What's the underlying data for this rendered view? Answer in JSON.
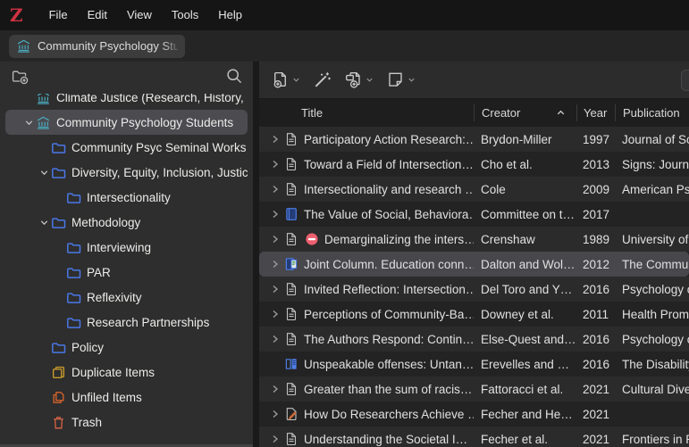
{
  "app": {
    "logo_letter": "Z",
    "menus": [
      {
        "label": "File"
      },
      {
        "label": "Edit"
      },
      {
        "label": "View"
      },
      {
        "label": "Tools"
      },
      {
        "label": "Help"
      }
    ]
  },
  "tab_bar": {
    "tabs": [
      {
        "label": "Community Psychology Stude",
        "icon": "library"
      }
    ]
  },
  "sidebar": {
    "items": [
      {
        "label": "Climate Justice (Research, History, Bell",
        "icon": "library",
        "depth": 0,
        "chevron": false,
        "selected": false,
        "clipped": true
      },
      {
        "label": "Community Psychology Students",
        "icon": "library",
        "depth": 0,
        "chevron": true,
        "selected": true,
        "clipped": false
      },
      {
        "label": "Community Psyc Seminal Works",
        "icon": "folder",
        "depth": 1,
        "chevron": false,
        "selected": false,
        "clipped": false
      },
      {
        "label": "Diversity, Equity, Inclusion, Justice",
        "icon": "folder",
        "depth": 1,
        "chevron": true,
        "selected": false,
        "clipped": false
      },
      {
        "label": "Intersectionality",
        "icon": "folder",
        "depth": 2,
        "chevron": false,
        "selected": false,
        "clipped": false
      },
      {
        "label": "Methodology",
        "icon": "folder",
        "depth": 1,
        "chevron": true,
        "selected": false,
        "clipped": false
      },
      {
        "label": "Interviewing",
        "icon": "folder",
        "depth": 2,
        "chevron": false,
        "selected": false,
        "clipped": false
      },
      {
        "label": "PAR",
        "icon": "folder",
        "depth": 2,
        "chevron": false,
        "selected": false,
        "clipped": false
      },
      {
        "label": "Reflexivity",
        "icon": "folder",
        "depth": 2,
        "chevron": false,
        "selected": false,
        "clipped": false
      },
      {
        "label": "Research Partnerships",
        "icon": "folder",
        "depth": 2,
        "chevron": false,
        "selected": false,
        "clipped": false
      },
      {
        "label": "Policy",
        "icon": "folder",
        "depth": 1,
        "chevron": false,
        "selected": false,
        "clipped": false
      },
      {
        "label": "Duplicate Items",
        "icon": "duplicates",
        "depth": 1,
        "chevron": false,
        "selected": false,
        "clipped": false
      },
      {
        "label": "Unfiled Items",
        "icon": "unfiled",
        "depth": 1,
        "chevron": false,
        "selected": false,
        "clipped": false
      },
      {
        "label": "Trash",
        "icon": "trash",
        "depth": 1,
        "chevron": false,
        "selected": false,
        "clipped": false
      }
    ]
  },
  "main": {
    "toolbar": {
      "buttons": [
        {
          "name": "new-item",
          "icon": "new-item",
          "dropdown": true
        },
        {
          "name": "add-by-identifier",
          "icon": "wand",
          "dropdown": false
        },
        {
          "name": "new-attachment",
          "icon": "attachment",
          "dropdown": true
        },
        {
          "name": "new-note",
          "icon": "note",
          "dropdown": true
        }
      ]
    },
    "table": {
      "columns": [
        {
          "id": "title",
          "label": "Title",
          "sort": null
        },
        {
          "id": "creator",
          "label": "Creator",
          "sort": "asc"
        },
        {
          "id": "year",
          "label": "Year",
          "sort": null
        },
        {
          "id": "publication",
          "label": "Publication",
          "sort": null
        }
      ],
      "rows": [
        {
          "twisty": true,
          "icon": "document",
          "emoji": false,
          "title": "Participatory Action Research:…",
          "creator": "Brydon-Miller",
          "year": "1997",
          "publication": "Journal of Soc",
          "selected": false
        },
        {
          "twisty": true,
          "icon": "document",
          "emoji": false,
          "title": "Toward a Field of Intersection…",
          "creator": "Cho et al.",
          "year": "2013",
          "publication": "Signs: Journa",
          "selected": false
        },
        {
          "twisty": true,
          "icon": "document",
          "emoji": false,
          "title": "Intersectionality and research …",
          "creator": "Cole",
          "year": "2009",
          "publication": "American Psy",
          "selected": false
        },
        {
          "twisty": true,
          "icon": "book",
          "emoji": false,
          "title": "The Value of Social, Behaviora…",
          "creator": "Committee on t…",
          "year": "2017",
          "publication": "",
          "selected": false
        },
        {
          "twisty": true,
          "icon": "document",
          "emoji": true,
          "title": "Demarginalizing the inters…",
          "creator": "Crenshaw",
          "year": "1989",
          "publication": "University of ",
          "selected": false
        },
        {
          "twisty": true,
          "icon": "magazine",
          "emoji": false,
          "title": "Joint Column. Education conn…",
          "creator": "Dalton and Wol…",
          "year": "2012",
          "publication": "The Commun",
          "selected": true
        },
        {
          "twisty": true,
          "icon": "document",
          "emoji": false,
          "title": "Invited Reflection: Intersection…",
          "creator": "Del Toro and Y…",
          "year": "2016",
          "publication": "Psychology o",
          "selected": false
        },
        {
          "twisty": true,
          "icon": "document",
          "emoji": false,
          "title": "Perceptions of Community-Ba…",
          "creator": "Downey et al.",
          "year": "2011",
          "publication": "Health Prom",
          "selected": false
        },
        {
          "twisty": true,
          "icon": "document",
          "emoji": false,
          "title": "The Authors Respond: Contin…",
          "creator": "Else-Quest and…",
          "year": "2016",
          "publication": "Psychology o",
          "selected": false
        },
        {
          "twisty": false,
          "icon": "book-section",
          "emoji": false,
          "title": "Unspeakable offenses: Untan…",
          "creator": "Erevelles and …",
          "year": "2016",
          "publication": "The Disability",
          "selected": false
        },
        {
          "twisty": true,
          "icon": "document",
          "emoji": false,
          "title": "Greater than the sum of racis…",
          "creator": "Fattoracci et al.",
          "year": "2021",
          "publication": "Cultural Diver",
          "selected": false
        },
        {
          "twisty": true,
          "icon": "blog",
          "emoji": false,
          "title": "How Do Researchers Achieve …",
          "creator": "Fecher and He…",
          "year": "2021",
          "publication": "",
          "selected": false
        },
        {
          "twisty": true,
          "icon": "document",
          "emoji": false,
          "title": "Understanding the Societal I…",
          "creator": "Fecher et al.",
          "year": "2021",
          "publication": "Frontiers in R",
          "selected": false
        }
      ]
    }
  },
  "colors": {
    "logo_red": "#cf3341",
    "library_teal": "#4aa9bd",
    "folder_blue": "#4a78e8",
    "duplicates_gold": "#c79b2a",
    "unfiled_orange": "#d2622b",
    "trash_red": "#cf6045",
    "selection_gray": "#47474c",
    "sidebar_selection": "#4b4b50",
    "no_entry_emoji": "#ec5f6f"
  }
}
